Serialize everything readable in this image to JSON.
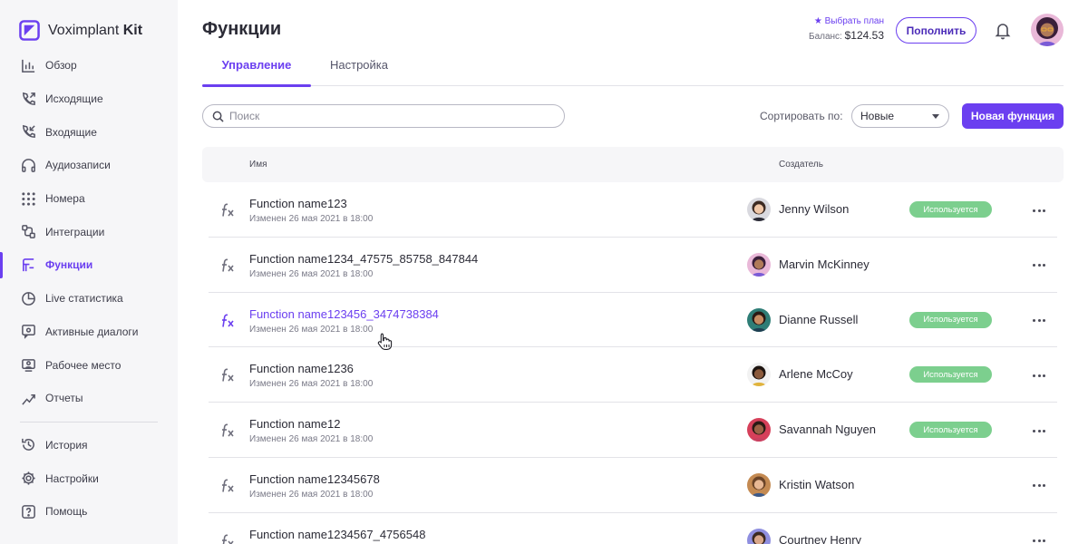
{
  "app": {
    "name_regular": "Voximplant",
    "name_bold": "Kit"
  },
  "sidebar": {
    "items": [
      {
        "label": "Обзор",
        "icon": "chart-icon"
      },
      {
        "label": "Исходящие",
        "icon": "outgoing-call-icon"
      },
      {
        "label": "Входящие",
        "icon": "incoming-call-icon"
      },
      {
        "label": "Аудиозаписи",
        "icon": "headphones-icon"
      },
      {
        "label": "Номера",
        "icon": "dialpad-icon"
      },
      {
        "label": "Интеграции",
        "icon": "integrations-icon"
      },
      {
        "label": "Функции",
        "icon": "functions-icon",
        "active": true
      },
      {
        "label": "Live статистика",
        "icon": "pie-chart-icon"
      },
      {
        "label": "Активные диалоги",
        "icon": "active-dialogs-icon"
      },
      {
        "label": "Рабочее место",
        "icon": "workplace-icon"
      },
      {
        "label": "Отчеты",
        "icon": "reports-icon"
      }
    ],
    "bottom_items": [
      {
        "label": "История",
        "icon": "history-icon"
      },
      {
        "label": "Настройки",
        "icon": "settings-icon"
      },
      {
        "label": "Помощь",
        "icon": "help-icon"
      }
    ]
  },
  "header": {
    "title": "Функции",
    "plan_link": "★ Выбрать план",
    "balance_label": "Баланс:",
    "balance_value": "$124.53",
    "topup_label": "Пополнить"
  },
  "tabs": [
    {
      "label": "Управление",
      "active": true
    },
    {
      "label": "Настройка",
      "active": false
    }
  ],
  "toolbar": {
    "search_placeholder": "Поиск",
    "sort_label": "Сортировать по:",
    "sort_value": "Новые",
    "new_button": "Новая функция"
  },
  "table": {
    "columns": {
      "name": "Имя",
      "creator": "Создатель"
    },
    "rows": [
      {
        "name": "Function name123",
        "date": "Изменен 26 мая 2021 в 18:00",
        "creator": "Jenny Wilson",
        "status": "Используется",
        "hover": false
      },
      {
        "name": "Function name1234_47575_85758_847844",
        "date": "Изменен 26 мая 2021 в 18:00",
        "creator": "Marvin McKinney",
        "status": "",
        "hover": false
      },
      {
        "name": "Function name123456_3474738384",
        "date": "Изменен 26 мая 2021 в 18:00",
        "creator": "Dianne Russell",
        "status": "Используется",
        "hover": true
      },
      {
        "name": "Function name1236",
        "date": "Изменен 26 мая 2021 в 18:00",
        "creator": "Arlene McCoy",
        "status": "Используется",
        "hover": false
      },
      {
        "name": "Function name12",
        "date": "Изменен 26 мая 2021 в 18:00",
        "creator": "Savannah Nguyen",
        "status": "Используется",
        "hover": false
      },
      {
        "name": "Function name12345678",
        "date": "Изменен 26 мая 2021 в 18:00",
        "creator": "Kristin Watson",
        "status": "",
        "hover": false
      },
      {
        "name": "Function name1234567_4756548",
        "date": "",
        "creator": "Courtney Henry",
        "status": "",
        "hover": false
      }
    ]
  },
  "colors": {
    "accent": "#6b3ff0",
    "status_green": "#7ccf8e",
    "sidebar_bg": "#f6f6f8"
  }
}
